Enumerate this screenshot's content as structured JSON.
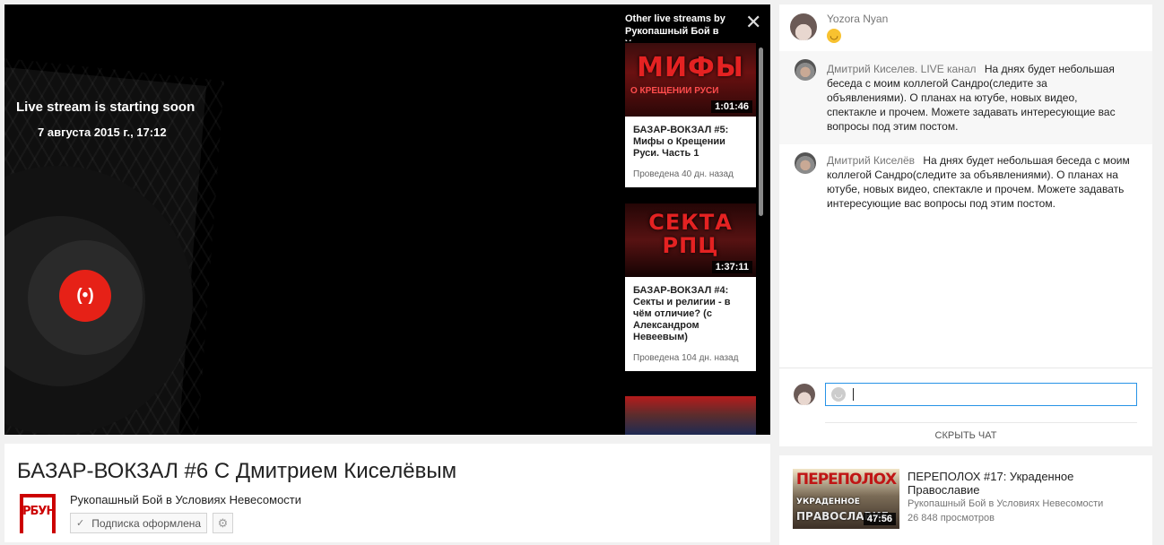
{
  "player": {
    "status_title": "Live stream is starting soon",
    "status_date": "7 августа 2015 г., 17:12",
    "live_icon": "live-broadcast-icon",
    "overlay": {
      "title": "Other live streams by Рукопашный Бой в Условиях Невесомости",
      "close_icon": "close-icon",
      "cards": [
        {
          "thumb_text": "МИФЫ",
          "thumb_sub": "О КРЕЩЕНИИ РУСИ",
          "duration": "1:01:46",
          "title": "БАЗАР-ВОКЗАЛ #5: Мифы о Крещении Руси. Часть 1",
          "meta": "Проведена 40 дн. назад"
        },
        {
          "thumb_text": "СЕКТА РПЦ",
          "duration": "1:37:11",
          "title": "БАЗАР-ВОКЗАЛ #4: Секты и религии - в чём отличие? (с Александром Невеевым)",
          "meta": "Проведена 104 дн. назад"
        }
      ]
    }
  },
  "video": {
    "title": "БАЗАР-ВОКЗАЛ #6 С Дмитрием Киселёвым",
    "channel_name": "Рукопашный Бой в Условиях Невесомости",
    "channel_logo_text": "РБУН",
    "subscribe_label": "Подписка оформлена",
    "subscribe_icon": "check-icon",
    "settings_icon": "gear-icon"
  },
  "chat": {
    "messages": [
      {
        "author": "Yozora Nyan",
        "emoji": "smiling-face-emoji"
      },
      {
        "author": "Дмитрий Киселев. LIVE канал",
        "text": "На днях будет небольшая беседа с моим коллегой Сандро(следите за объявлениями). О планах на ютубе, новых видео, спектакле и прочем. Можете задавать интересующие вас вопросы под этим постом."
      },
      {
        "author": "Дмитрий Киселёв",
        "text": "На днях будет небольшая беседа с моим коллегой Сандро(следите за объявлениями). О планах на ютубе, новых видео, спектакле и прочем. Можете задавать интересующие вас вопросы под этим постом."
      }
    ],
    "input_placeholder": "",
    "hide_chat_label": "СКРЫТЬ ЧАТ"
  },
  "related": {
    "thumb_top": "ПЕРЕПОЛОХ",
    "thumb_bottom": "ПРАВОСЛАВИЕ",
    "thumb_mid": "УКРАДЕННОЕ",
    "duration": "47:56",
    "title": "ПЕРЕПОЛОХ #17: Украденное Православие",
    "channel": "Рукопашный Бой в Условиях Невесомости",
    "views": "26 848 просмотров"
  },
  "colors": {
    "live_red": "#e62117",
    "input_focus": "#2793e6",
    "player_bg": "#000000",
    "page_bg": "#f1f1f1"
  }
}
